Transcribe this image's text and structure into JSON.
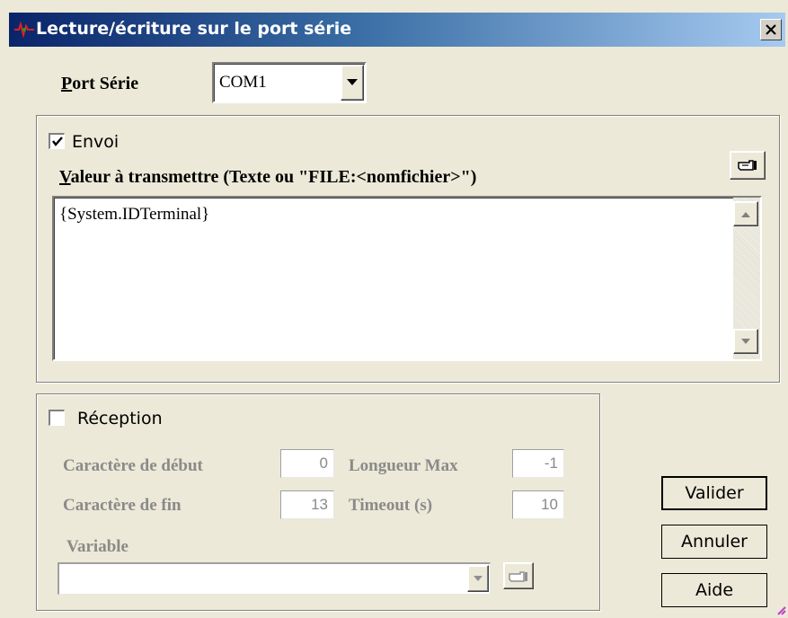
{
  "window": {
    "title": "Lecture/écriture sur le port série"
  },
  "port": {
    "label_underline": "P",
    "label_rest": "ort Série",
    "value": "COM1"
  },
  "envoi": {
    "checkbox_label": "Envoi",
    "checked": true,
    "value_label_underline": "V",
    "value_label_rest": "aleur à transmettre (Texte ou \"FILE:<nomfichier>\")",
    "value_text": "{System.IDTerminal}"
  },
  "reception": {
    "checkbox_label": "Réception",
    "checked": false,
    "start_char_label": "Caractère de début",
    "start_char_value": "0",
    "end_char_label": "Caractère de fin",
    "end_char_value": "13",
    "max_length_label": "Longueur Max",
    "max_length_value": "-1",
    "timeout_label": "Timeout (s)",
    "timeout_value": "10",
    "variable_label": "Variable",
    "variable_value": ""
  },
  "buttons": {
    "ok": "Valider",
    "cancel": "Annuler",
    "help": "Aide"
  },
  "colors": {
    "title_start": "#0a246a",
    "title_end": "#a6caf0",
    "face": "#ece9d8",
    "disabled_text": "#8a8a8a"
  }
}
